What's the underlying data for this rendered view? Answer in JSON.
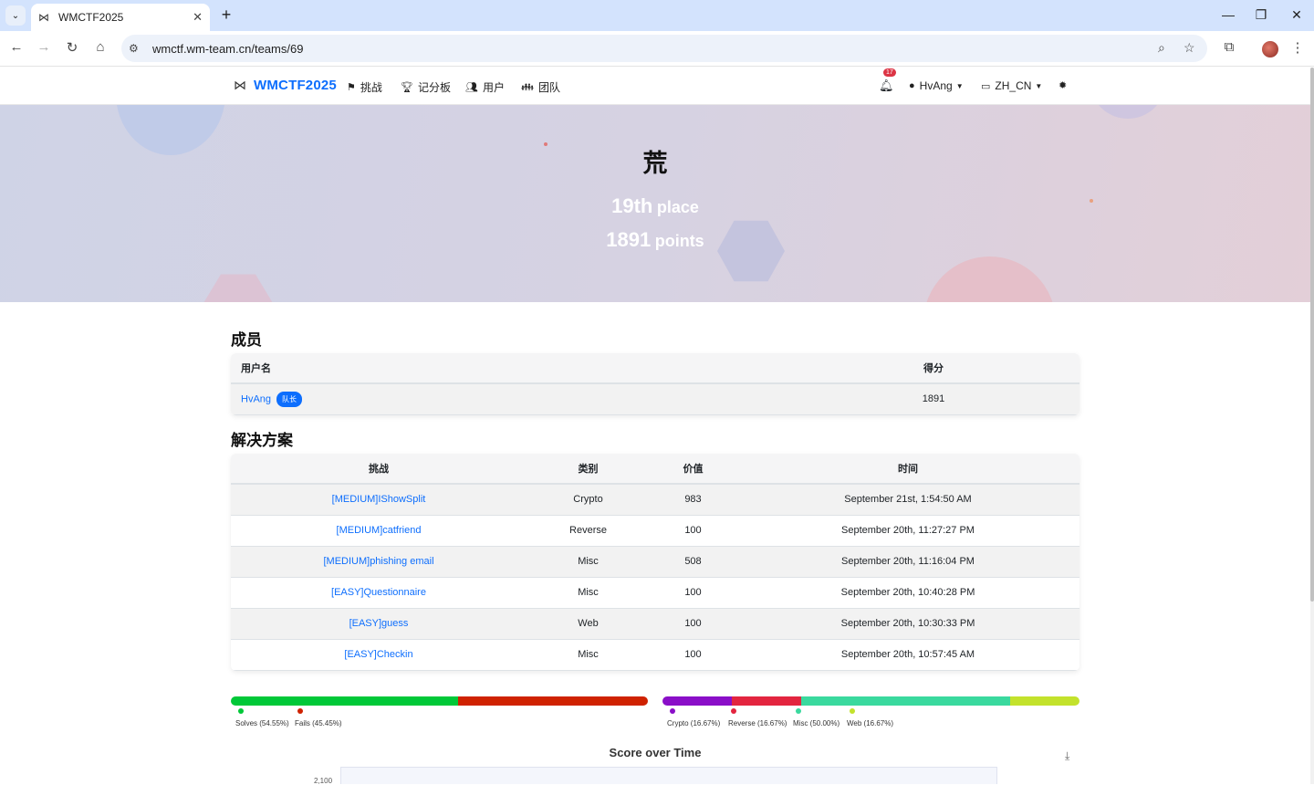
{
  "browser": {
    "tab_title": "WMCTF2025",
    "url": "wmctf.wm-team.cn/teams/69",
    "icons": [
      "tab-search-icon",
      "wm-logo-icon",
      "close-icon",
      "plus-icon",
      "minimize-icon",
      "restore-icon",
      "close-window-icon",
      "back-icon",
      "forward-icon",
      "reload-icon",
      "home-icon",
      "site-info-icon",
      "zoom-icon",
      "bookmark-star-icon",
      "extensions-icon",
      "profile-avatar"
    ]
  },
  "nav": {
    "brand": "WMCTF2025",
    "items": [
      "挑战",
      "记分板",
      "用户",
      "团队"
    ],
    "notification_count": "17",
    "user": "HvAng",
    "language": "ZH_CN"
  },
  "hero": {
    "team_name": "荒",
    "place_num": "19th",
    "place_label": "place",
    "points_num": "1891",
    "points_label": "points"
  },
  "members": {
    "title": "成员",
    "headers": [
      "用户名",
      "得分"
    ],
    "rows": [
      {
        "name": "HvAng",
        "badge": "队长",
        "score": "1891"
      }
    ]
  },
  "solves": {
    "title": "解决方案",
    "headers": [
      "挑战",
      "类别",
      "价值",
      "时间"
    ],
    "rows": [
      {
        "challenge": "[MEDIUM]IShowSplit",
        "category": "Crypto",
        "value": "983",
        "time": "September 21st, 1:54:50 AM"
      },
      {
        "challenge": "[MEDIUM]catfriend",
        "category": "Reverse",
        "value": "100",
        "time": "September 20th, 11:27:27 PM"
      },
      {
        "challenge": "[MEDIUM]phishing email",
        "category": "Misc",
        "value": "508",
        "time": "September 20th, 11:16:04 PM"
      },
      {
        "challenge": "[EASY]Questionnaire",
        "category": "Misc",
        "value": "100",
        "time": "September 20th, 10:40:28 PM"
      },
      {
        "challenge": "[EASY]guess",
        "category": "Web",
        "value": "100",
        "time": "September 20th, 10:30:33 PM"
      },
      {
        "challenge": "[EASY]Checkin",
        "category": "Misc",
        "value": "100",
        "time": "September 20th, 10:57:45 AM"
      }
    ]
  },
  "chart_data": [
    {
      "type": "bar",
      "stacked_percent": true,
      "series": [
        {
          "name": "Solves",
          "value": 54.55,
          "label": "Solves (54.55%)",
          "color": "#00c838"
        },
        {
          "name": "Fails",
          "value": 45.45,
          "label": "Fails (45.45%)",
          "color": "#cf2200"
        }
      ]
    },
    {
      "type": "bar",
      "stacked_percent": true,
      "series": [
        {
          "name": "Crypto",
          "value": 16.67,
          "label": "Crypto (16.67%)",
          "color": "#8a0fc8"
        },
        {
          "name": "Reverse",
          "value": 16.67,
          "label": "Reverse (16.67%)",
          "color": "#e3253f"
        },
        {
          "name": "Misc",
          "value": 50.0,
          "label": "Misc (50.00%)",
          "color": "#3ad99e"
        },
        {
          "name": "Web",
          "value": 16.67,
          "label": "Web (16.67%)",
          "color": "#c3e22c"
        }
      ]
    },
    {
      "type": "line",
      "title": "Score over Time",
      "y_tick_top": "2,100"
    }
  ]
}
